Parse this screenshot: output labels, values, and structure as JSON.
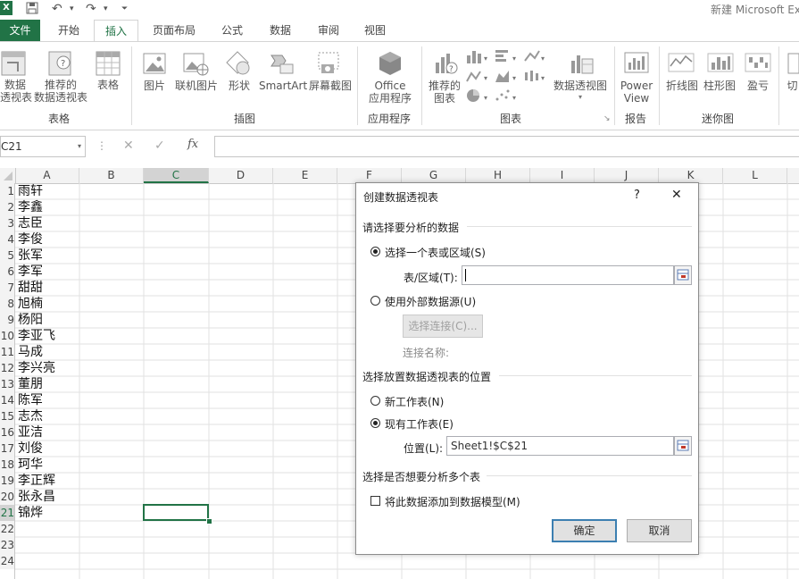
{
  "titlebar": {
    "title": "新建 Microsoft Ex"
  },
  "tabs": [
    "文件",
    "开始",
    "插入",
    "页面布局",
    "公式",
    "数据",
    "审阅",
    "视图"
  ],
  "ribbon": {
    "buttons": {
      "pivot": "数据\n透视表",
      "rec_pivot": "推荐的\n数据透视表",
      "table": "表格",
      "picture": "图片",
      "online_picture": "联机图片",
      "shapes": "形状",
      "smartart": "SmartArt",
      "screenshot": "屏幕截图",
      "office_apps": "Office\n应用程序",
      "rec_charts": "推荐的\n图表",
      "pivot_chart": "数据透视图",
      "power_view": "Power\nView",
      "spark_line": "折线图",
      "spark_column": "柱形图",
      "spark_winloss": "盈亏",
      "slicer": "切"
    },
    "groups": {
      "tables": "表格",
      "illustrations": "插图",
      "apps": "应用程序",
      "charts": "图表",
      "reports": "报告",
      "sparklines": "迷你图"
    }
  },
  "formula_bar": {
    "name_box": "C21",
    "fx": "fx",
    "cancel": "✕",
    "enter": "✓"
  },
  "grid": {
    "columns": [
      "A",
      "B",
      "C",
      "D",
      "E",
      "F",
      "G",
      "H",
      "I",
      "J",
      "K",
      "L"
    ],
    "rows": [
      "1",
      "2",
      "3",
      "4",
      "5",
      "6",
      "7",
      "8",
      "9",
      "10",
      "11",
      "12",
      "13",
      "14",
      "15",
      "16",
      "17",
      "18",
      "19",
      "20",
      "21",
      "22",
      "23",
      "24"
    ],
    "names": [
      "雨轩",
      "李鑫",
      "志臣",
      "李俊",
      "张军",
      "李军",
      "甜甜",
      "旭楠",
      "杨阳",
      "李亚飞",
      "马成",
      "李兴亮",
      "董朋",
      "陈军",
      "志杰",
      "亚洁",
      "刘俊",
      "珂华",
      "李正辉",
      "张永昌",
      "锦烨"
    ]
  },
  "dialog": {
    "title": "创建数据透视表",
    "help": "?",
    "close": "✕",
    "section1": "请选择要分析的数据",
    "opt_range": "选择一个表或区域(S)",
    "range_label": "表/区域(T):",
    "range_value": "",
    "opt_external": "使用外部数据源(U)",
    "choose_conn": "选择连接(C)...",
    "conn_name": "连接名称:",
    "section2": "选择放置数据透视表的位置",
    "opt_new": "新工作表(N)",
    "opt_existing": "现有工作表(E)",
    "location_label": "位置(L):",
    "location_value": "Sheet1!$C$21",
    "section3": "选择是否想要分析多个表",
    "add_model": "将此数据添加到数据模型(M)",
    "ok": "确定",
    "cancel": "取消"
  },
  "colors": {
    "excel_green": "#217346",
    "selection": "#217346"
  }
}
